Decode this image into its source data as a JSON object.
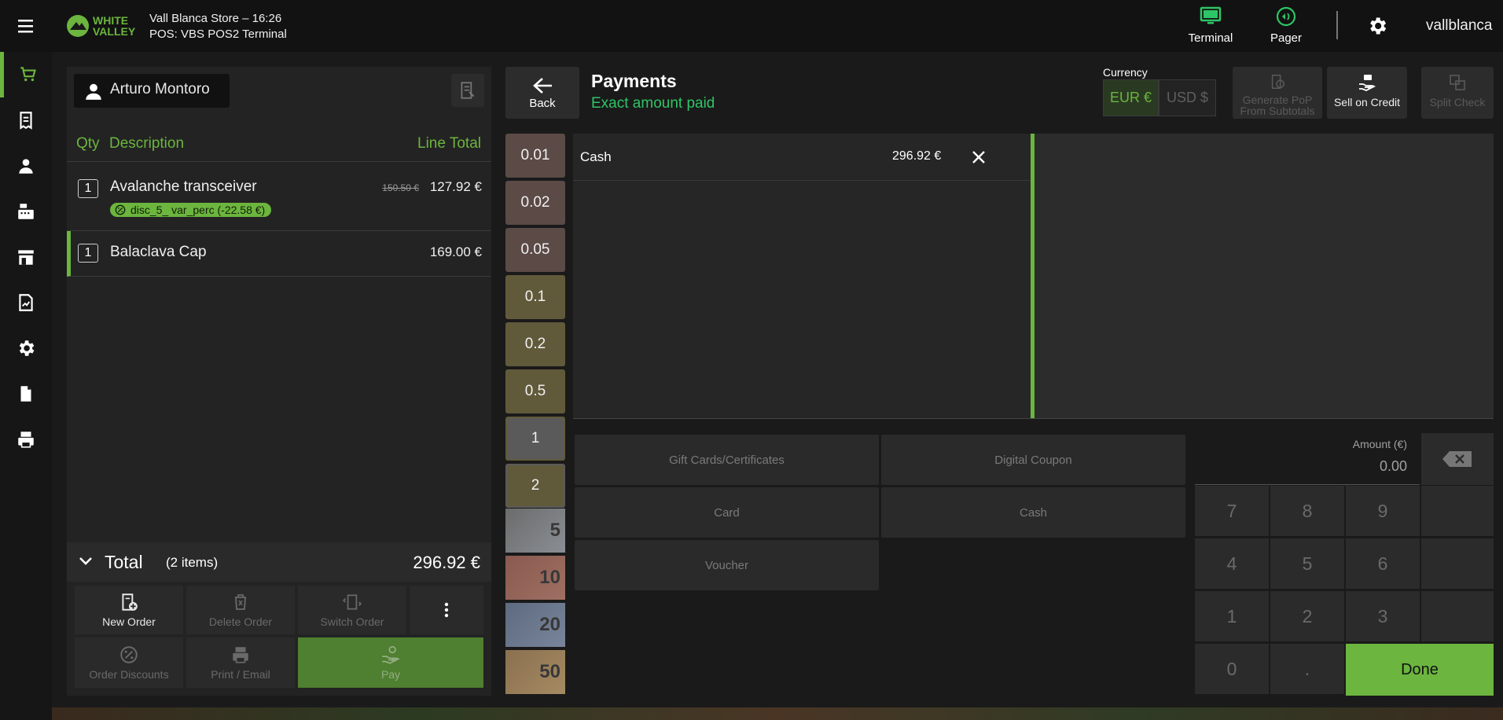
{
  "header": {
    "brand_line1": "WHITE",
    "brand_line2": "VALLEY",
    "store_line": "Vall Blanca Store – 16:26",
    "terminal_line": "POS: VBS POS2 Terminal",
    "terminal_label": "Terminal",
    "pager_label": "Pager",
    "username": "vallblanca"
  },
  "sidebar": {
    "items": [
      {
        "icon": "cart-icon",
        "active": true
      },
      {
        "icon": "receipt-icon"
      },
      {
        "icon": "person-icon"
      },
      {
        "icon": "cash-register-icon"
      },
      {
        "icon": "store-icon"
      },
      {
        "icon": "report-icon"
      },
      {
        "icon": "gear-icon"
      },
      {
        "icon": "document-icon"
      },
      {
        "icon": "printer-icon"
      }
    ]
  },
  "order": {
    "customer_name": "Arturo Montoro",
    "columns": {
      "qty": "Qty",
      "description": "Description",
      "line_total": "Line Total"
    },
    "lines": [
      {
        "qty": "1",
        "description": "Avalanche transceiver",
        "original_price": "150.50 €",
        "price": "127.92 €",
        "discount": "disc_5_ var_perc (-22.58 €)"
      },
      {
        "qty": "1",
        "description": "Balaclava Cap",
        "price": "169.00 €"
      }
    ],
    "total_label": "Total",
    "items_count": "(2 items)",
    "total_value": "296.92 €",
    "buttons": {
      "new_order": "New Order",
      "delete_order": "Delete Order",
      "switch_order": "Switch Order",
      "order_discounts": "Order Discounts",
      "print_email": "Print / Email",
      "pay": "Pay"
    }
  },
  "payments": {
    "back_label": "Back",
    "title": "Payments",
    "status": "Exact amount paid",
    "currency_label": "Currency",
    "currency_eur": "EUR €",
    "currency_usd": "USD $",
    "actions": {
      "generate_pop_1": "Generate PoP",
      "generate_pop_2": "From Subtotals",
      "sell_on_credit": "Sell on Credit",
      "split_check": "Split Check"
    },
    "coins": [
      "0.01",
      "0.02",
      "0.05",
      "0.1",
      "0.2",
      "0.5",
      "1",
      "2"
    ],
    "notes": [
      "5",
      "10",
      "20",
      "50"
    ],
    "lines": [
      {
        "method": "Cash",
        "amount": "296.92 €"
      }
    ],
    "methods": {
      "gift_cards": "Gift Cards/Certificates",
      "digital_coupon": "Digital Coupon",
      "card": "Card",
      "cash": "Cash",
      "voucher": "Voucher"
    },
    "amount_label": "Amount (€)",
    "amount_value": "0.00",
    "keys": [
      "7",
      "8",
      "9",
      "4",
      "5",
      "6",
      "1",
      "2",
      "3",
      "0",
      "."
    ],
    "done": "Done"
  },
  "colors": {
    "accent": "#6cb53e",
    "background": "#1a1a1a"
  }
}
